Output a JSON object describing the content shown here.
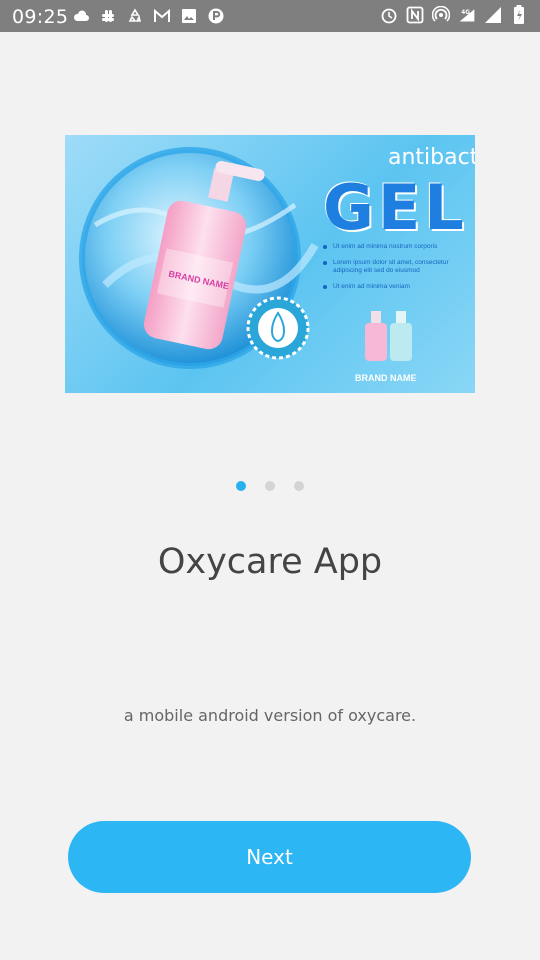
{
  "status_bar": {
    "time": "09:25",
    "left_icons": [
      "cloud-icon",
      "slack-icon",
      "recycle-icon",
      "gmail-icon",
      "image-icon",
      "p-icon"
    ],
    "right_icons": [
      "alarm-icon",
      "nfc-icon",
      "hotspot-icon",
      "signal-4g-icon",
      "signal-icon",
      "battery-icon"
    ]
  },
  "banner": {
    "title_small": "antibacterial",
    "title_big": "GEL",
    "bullets": [
      "Ut enim ad minima nostrum corporis",
      "Lorem ipsum dolor sit amet, consectetur adipiscing elit sed do eiusmod",
      "Ut enim ad minima veniam"
    ],
    "bottle_label": "BRAND NAME",
    "brand_name": "BRAND NAME",
    "colors": {
      "accent": "#1e7fe0",
      "bottle": "#f7b7d2"
    }
  },
  "pager": {
    "count": 3,
    "active_index": 0
  },
  "content": {
    "title": "Oxycare App",
    "description": "a mobile android version of oxycare."
  },
  "actions": {
    "next_label": "Next"
  },
  "colors": {
    "primary": "#2cb6f4",
    "background": "#f2f2f2",
    "status_bar": "#7f7f7f"
  }
}
